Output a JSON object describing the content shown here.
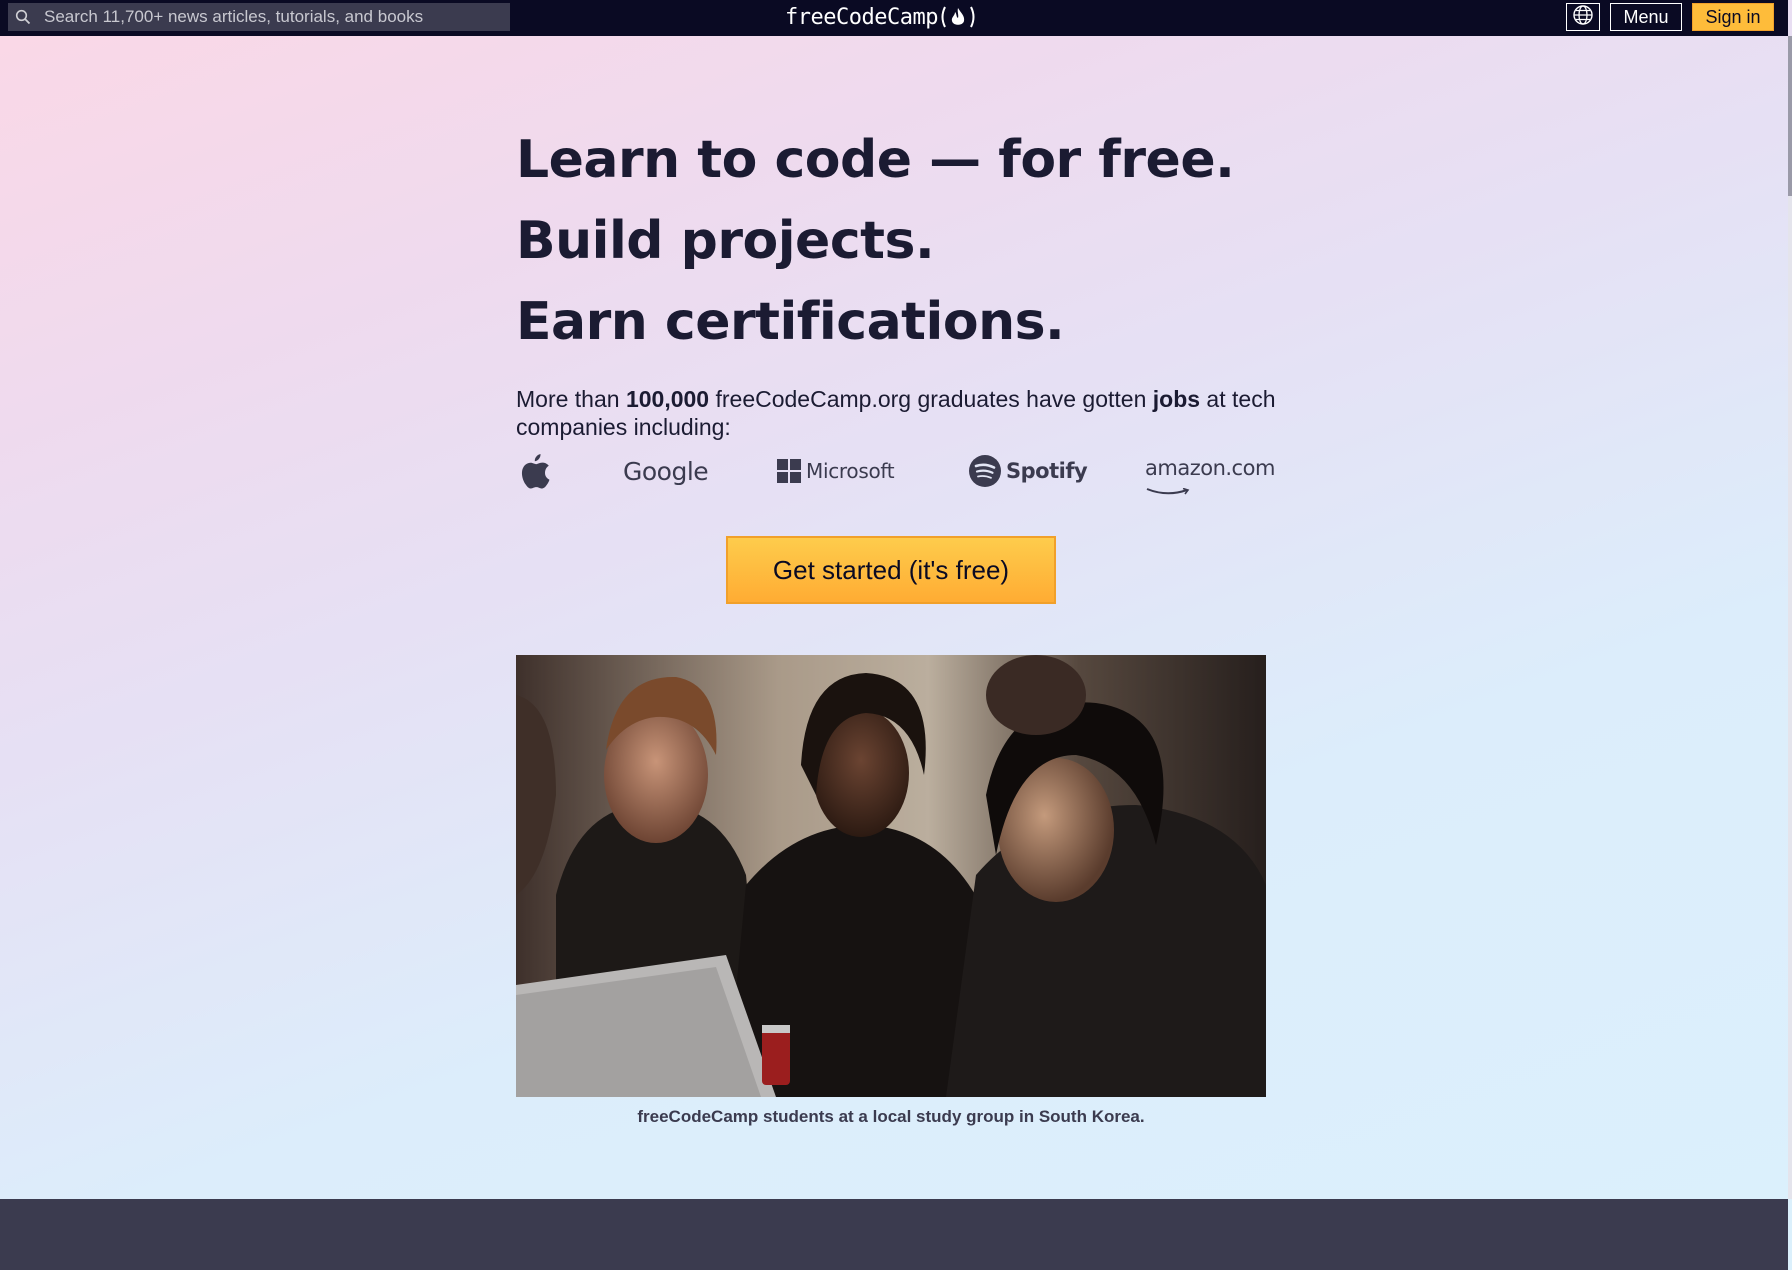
{
  "nav": {
    "search_placeholder": "Search 11,700+ news articles, tutorials, and books",
    "logo_text": "freeCodeCamp",
    "language_icon": "globe-icon",
    "menu_label": "Menu",
    "signin_label": "Sign in"
  },
  "hero": {
    "headline_1": "Learn to code — for free.",
    "headline_2": "Build projects.",
    "headline_3": "Earn certifications.",
    "lead_part_1": "More than ",
    "lead_bold_1": "100,000",
    "lead_part_2": " freeCodeCamp.org graduates have gotten ",
    "lead_bold_2": "jobs",
    "lead_part_3": " at tech companies including:"
  },
  "companies": {
    "google": "Google",
    "microsoft": "Microsoft",
    "spotify": "Spotify",
    "amazon": "amazon.com"
  },
  "cta": {
    "label": "Get started (it's free)"
  },
  "photo": {
    "caption": "freeCodeCamp students at a local study group in South Korea."
  },
  "colors": {
    "nav_bg": "#0a0a23",
    "accent_yellow": "#febc3a",
    "text_dark": "#1b1b32",
    "footer": "#3b3b4f"
  }
}
